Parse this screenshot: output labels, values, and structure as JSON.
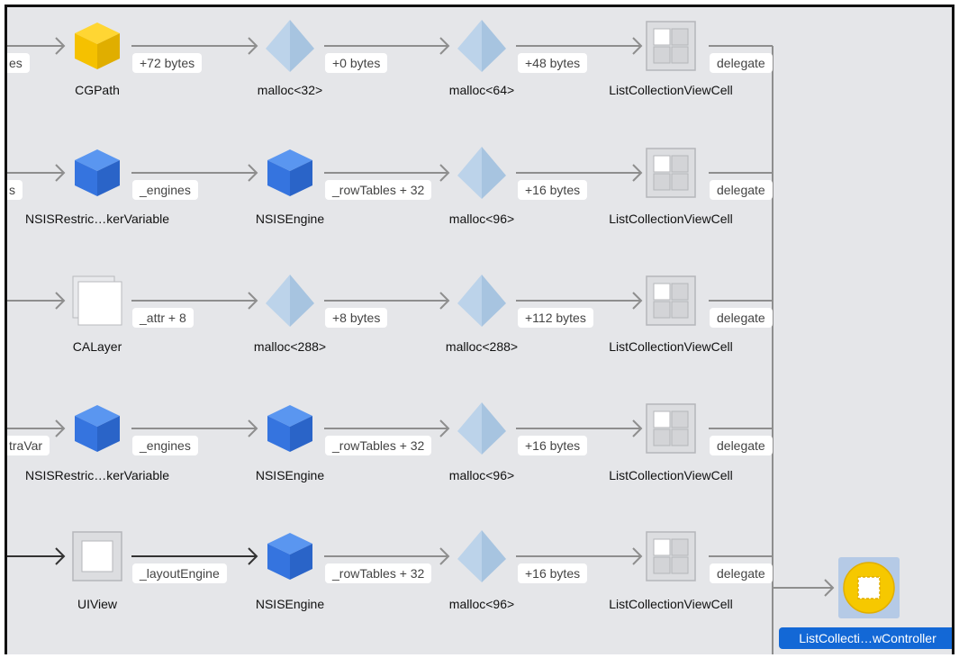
{
  "graph": {
    "rows": [
      {
        "left_stub": "es",
        "nodes": [
          {
            "label": "CGPath",
            "icon": "yellow-cube-icon"
          },
          {
            "label": "malloc<32>",
            "icon": "malloc-pyramid-icon"
          },
          {
            "label": "malloc<64>",
            "icon": "malloc-pyramid-icon"
          },
          {
            "label": "ListCollectionViewCell",
            "icon": "grid-icon"
          }
        ],
        "edges": [
          "+72 bytes",
          "+0 bytes",
          "+48 bytes",
          "delegate"
        ]
      },
      {
        "left_stub": "s",
        "nodes": [
          {
            "label": "NSISRestric…kerVariable",
            "icon": "blue-cube-icon"
          },
          {
            "label": "NSISEngine",
            "icon": "blue-cube-icon"
          },
          {
            "label": "malloc<96>",
            "icon": "malloc-pyramid-icon"
          },
          {
            "label": "ListCollectionViewCell",
            "icon": "grid-icon"
          }
        ],
        "edges": [
          "_engines",
          "_rowTables + 32",
          "+16 bytes",
          "delegate"
        ]
      },
      {
        "left_stub": "",
        "nodes": [
          {
            "label": "CALayer",
            "icon": "layer-icon"
          },
          {
            "label": "malloc<288>",
            "icon": "malloc-pyramid-icon"
          },
          {
            "label": "malloc<288>",
            "icon": "malloc-pyramid-icon"
          },
          {
            "label": "ListCollectionViewCell",
            "icon": "grid-icon"
          }
        ],
        "edges": [
          "_attr + 8",
          "+8 bytes",
          "+112 bytes",
          "delegate"
        ]
      },
      {
        "left_stub": "traVar",
        "nodes": [
          {
            "label": "NSISRestric…kerVariable",
            "icon": "blue-cube-icon"
          },
          {
            "label": "NSISEngine",
            "icon": "blue-cube-icon"
          },
          {
            "label": "malloc<96>",
            "icon": "malloc-pyramid-icon"
          },
          {
            "label": "ListCollectionViewCell",
            "icon": "grid-icon"
          }
        ],
        "edges": [
          "_engines",
          "_rowTables + 32",
          "+16 bytes",
          "delegate"
        ]
      },
      {
        "left_stub": "",
        "nodes": [
          {
            "label": "UIView",
            "icon": "view-icon"
          },
          {
            "label": "NSISEngine",
            "icon": "blue-cube-icon"
          },
          {
            "label": "malloc<96>",
            "icon": "malloc-pyramid-icon"
          },
          {
            "label": "ListCollectionViewCell",
            "icon": "grid-icon"
          }
        ],
        "edges": [
          "_layoutEngine",
          "_rowTables + 32",
          "+16 bytes",
          "delegate"
        ]
      }
    ],
    "selected_node": {
      "label": "ListCollecti…wController",
      "icon": "view-controller-icon"
    }
  },
  "colors": {
    "selection": "#1368d6",
    "wire": "#8e8e8e",
    "wire_dark": "#333333",
    "cube_blue": "#3d7fe8",
    "cube_yellow": "#f7c600",
    "malloc": "#a9c6e2"
  }
}
